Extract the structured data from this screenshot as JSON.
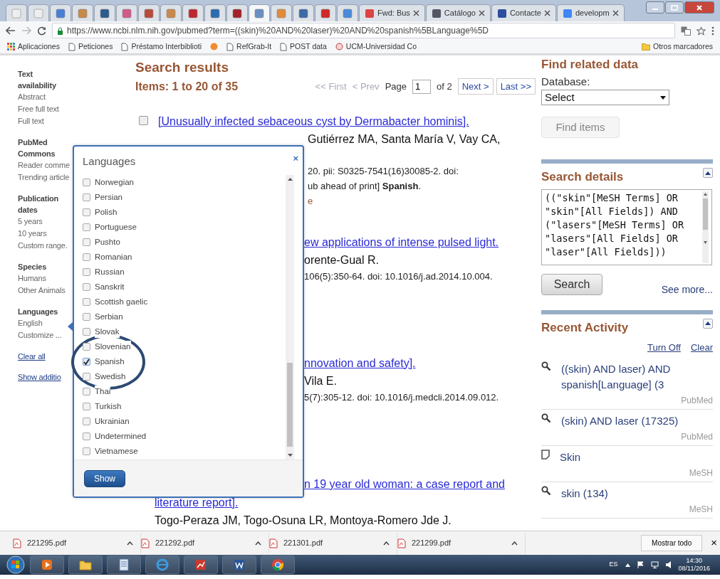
{
  "browser": {
    "tabs": [
      {
        "selected": false
      },
      {
        "selected": false
      },
      {
        "selected": false
      },
      {
        "selected": false
      },
      {
        "selected": false
      },
      {
        "selected": false
      },
      {
        "selected": false
      },
      {
        "selected": false
      },
      {
        "selected": false
      },
      {
        "selected": false
      },
      {
        "selected": false
      },
      {
        "selected": true
      },
      {
        "selected": false
      },
      {
        "selected": false
      },
      {
        "selected": false
      },
      {
        "selected": false
      },
      {
        "label": "Fwd: Bus",
        "selected": false
      },
      {
        "label": "Catálogo",
        "selected": false
      },
      {
        "label": "Contacte",
        "selected": false
      },
      {
        "label": "developm",
        "selected": false
      }
    ],
    "url": "https://www.ncbi.nlm.nih.gov/pubmed?term=((skin)%20AND%20laser)%20AND%20spanish%5BLanguage%5D",
    "bookmarks": [
      "Aplicaciones",
      "Peticiones",
      "Préstamo Interbiblioti",
      "RefGrab-It",
      "POST data",
      "UCM-Universidad Co"
    ],
    "other_bookmarks": "Otros marcadores"
  },
  "sidebar": {
    "groups": [
      {
        "heading": "Text availability",
        "items": [
          "Abstract",
          "Free full text",
          "Full text"
        ]
      },
      {
        "heading": "PubMed Commons",
        "items": [
          "Reader comme",
          "Trending article"
        ]
      },
      {
        "heading": "Publication dates",
        "items": [
          "5 years",
          "10 years",
          "Custom range."
        ]
      },
      {
        "heading": "Species",
        "items": [
          "Humans",
          "Other Animals"
        ]
      },
      {
        "heading": "Languages",
        "items": [
          "English",
          "Customize ..."
        ]
      }
    ],
    "links": [
      "Clear all",
      "Show additio"
    ]
  },
  "main": {
    "title": "Search results",
    "count": "Items: 1 to 20 of 35",
    "pager": {
      "first": {
        "label": "<< First",
        "disabled": true
      },
      "prev": {
        "label": "< Prev",
        "disabled": true
      },
      "page_label": "Page",
      "page": "1",
      "of": "of 2",
      "next": {
        "label": "Next >",
        "disabled": false
      },
      "last": {
        "label": "Last >>",
        "disabled": false
      }
    },
    "results": [
      {
        "checked": false,
        "title_lines": [
          "[Unusually infected sebaceous cyst by Dermabacter hominis]."
        ],
        "lines": [
          {
            "kind": "authors",
            "text": "Gutiérrez MA, Santa María V, Vay CA,"
          },
          {
            "kind": "citation",
            "text": "20. pii: S0325-7541(16)30085-2. doi:"
          },
          {
            "kind": "citation",
            "text": "ub ahead of print] **Spanish**."
          },
          {
            "kind": "link",
            "text": "e"
          }
        ]
      },
      {
        "title_lines": [
          "ew applications of intense pulsed light."
        ],
        "lines": [
          {
            "kind": "authors",
            "text": "orente-Gual R."
          },
          {
            "kind": "citation",
            "text": "106(5):350-64. doi: 10.1016/j.ad.2014.10.004."
          }
        ]
      },
      {
        "title_lines": [
          "nnovation and safety]."
        ],
        "lines": [
          {
            "kind": "authors",
            "text": "Vila E."
          },
          {
            "kind": "citation",
            "text": "5(7):305-12. doi: 10.1016/j.medcli.2014.09.012."
          }
        ]
      },
      {
        "title_lines": [
          "n 19 year old woman: a case report and",
          "literature report]."
        ],
        "lines": [
          {
            "kind": "authors",
            "text": "Togo-Peraza JM, Togo-Osuna LR, Montoya-Romero Jde J."
          }
        ]
      }
    ]
  },
  "right": {
    "find_related": {
      "title": "Find related data",
      "database_label": "Database:",
      "database": "Select",
      "button": {
        "label": "Find items",
        "disabled": true
      }
    },
    "search_details": {
      "title": "Search details",
      "query": "((\"skin\"[MeSH Terms] OR \"skin\"[All Fields]) AND (\"lasers\"[MeSH Terms] OR \"lasers\"[All Fields] OR \"laser\"[All Fields]))",
      "button": "Search",
      "more": "See more..."
    },
    "recent_activity": {
      "title": "Recent Activity",
      "links": [
        "Turn Off",
        "Clear"
      ],
      "items": [
        {
          "kind": "search",
          "text": "((skin) AND laser) AND spanish[Language] (3",
          "source": "PubMed"
        },
        {
          "kind": "search",
          "text": "(skin) AND laser (17325)",
          "source": "PubMed"
        },
        {
          "kind": "document",
          "text": "Skin",
          "source": "MeSH"
        },
        {
          "kind": "search",
          "text": "skin (134)",
          "source": "MeSH"
        }
      ]
    }
  },
  "languages_dialog": {
    "title": "Languages",
    "close": "×",
    "items": [
      {
        "label": "Norwegian",
        "checked": false
      },
      {
        "label": "Persian",
        "checked": false
      },
      {
        "label": "Polish",
        "checked": false
      },
      {
        "label": "Portuguese",
        "checked": false
      },
      {
        "label": "Pushto",
        "checked": false
      },
      {
        "label": "Romanian",
        "checked": false
      },
      {
        "label": "Russian",
        "checked": false
      },
      {
        "label": "Sanskrit",
        "checked": false
      },
      {
        "label": "Scottish gaelic",
        "checked": false
      },
      {
        "label": "Serbian",
        "checked": false
      },
      {
        "label": "Slovak",
        "checked": false
      },
      {
        "label": "Slovenian",
        "checked": false
      },
      {
        "label": "Spanish",
        "checked": true
      },
      {
        "label": "Swedish",
        "checked": false
      },
      {
        "label": "Thai",
        "checked": false
      },
      {
        "label": "Turkish",
        "checked": false
      },
      {
        "label": "Ukrainian",
        "checked": false
      },
      {
        "label": "Undetermined",
        "checked": false
      },
      {
        "label": "Vietnamese",
        "checked": false
      }
    ],
    "button": "Show"
  },
  "downloads": {
    "files": [
      "221295.pdf",
      "221292.pdf",
      "221301.pdf",
      "221299.pdf"
    ],
    "show_all": "Mostrar todo",
    "close": "×"
  },
  "taskbar": {
    "language": "ES",
    "time": "14:30",
    "date": "08/11/2016"
  }
}
